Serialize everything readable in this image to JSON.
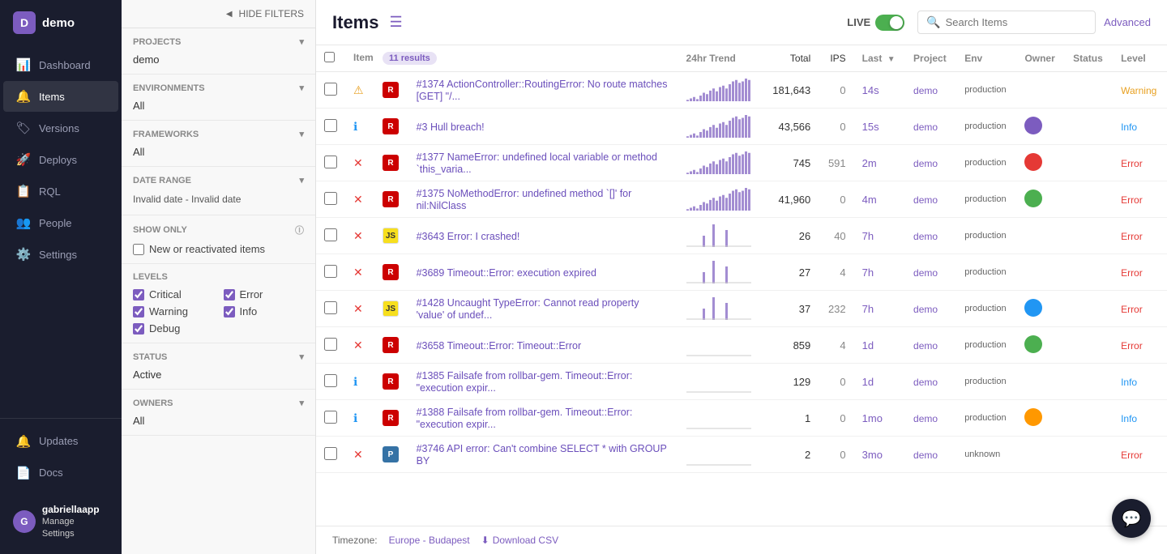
{
  "sidebar": {
    "app_name": "demo",
    "items": [
      {
        "label": "Dashboard",
        "icon": "📊",
        "id": "dashboard"
      },
      {
        "label": "Items",
        "icon": "🔔",
        "id": "items",
        "active": true
      },
      {
        "label": "Versions",
        "icon": "🏷",
        "id": "versions"
      },
      {
        "label": "Deploys",
        "icon": "🚀",
        "id": "deploys"
      },
      {
        "label": "RQL",
        "icon": "📋",
        "id": "rql"
      },
      {
        "label": "People",
        "icon": "👥",
        "id": "people"
      },
      {
        "label": "Settings",
        "icon": "⚙️",
        "id": "settings"
      }
    ],
    "bottom_items": [
      {
        "label": "Updates",
        "icon": "🔔",
        "id": "updates"
      },
      {
        "label": "Docs",
        "icon": "📄",
        "id": "docs"
      }
    ],
    "user": {
      "name": "gabriellaapp",
      "sub": "Manage Settings"
    }
  },
  "filters": {
    "hide_filters_label": "HIDE FILTERS",
    "projects_label": "PROJECTS",
    "project_value": "demo",
    "environments_label": "ENVIRONMENTS",
    "environments_value": "All",
    "frameworks_label": "FRAMEWORKS",
    "frameworks_value": "All",
    "date_range_label": "DATE RANGE",
    "date_range_value": "Invalid date - Invalid date",
    "show_only_label": "SHOW ONLY",
    "new_reactivated_label": "New or reactivated items",
    "levels_label": "LEVELS",
    "levels": [
      {
        "label": "Critical",
        "checked": true
      },
      {
        "label": "Error",
        "checked": true
      },
      {
        "label": "Warning",
        "checked": true
      },
      {
        "label": "Info",
        "checked": true
      },
      {
        "label": "Debug",
        "checked": true
      }
    ],
    "status_label": "STATUS",
    "status_value": "Active",
    "owners_label": "OWNERS",
    "owners_value": "All"
  },
  "main": {
    "title": "Items",
    "live_label": "LIVE",
    "search_placeholder": "Search Items",
    "advanced_label": "Advanced",
    "results_count": "11 results",
    "columns": {
      "item": "Item",
      "trend": "24hr Trend",
      "total": "Total",
      "ips": "IPS",
      "last": "Last",
      "project": "Project",
      "env": "Env",
      "owner": "Owner",
      "status": "Status",
      "level": "Level"
    },
    "items": [
      {
        "id": "#1374",
        "level": "Warning",
        "platform": "ruby",
        "title": "ActionController::RoutingError: No route matches [GET] \"/...",
        "total": "181,643",
        "ips": "0",
        "last": "14s",
        "project": "demo",
        "env": "production",
        "owner": "",
        "status": "",
        "level_badge": "Warning",
        "sparkline_type": "high"
      },
      {
        "id": "#3",
        "level": "Info",
        "platform": "ruby",
        "title": "Hull breach!",
        "total": "43,566",
        "ips": "0",
        "last": "15s",
        "project": "demo",
        "env": "production",
        "owner": "av1",
        "status": "",
        "level_badge": "Info",
        "sparkline_type": "high"
      },
      {
        "id": "#1377",
        "level": "Error",
        "platform": "ruby",
        "title": "NameError: undefined local variable or method `this_varia...",
        "total": "745",
        "ips": "591",
        "last": "2m",
        "project": "demo",
        "env": "production",
        "owner": "av2",
        "status": "",
        "level_badge": "Error",
        "sparkline_type": "high"
      },
      {
        "id": "#1375",
        "level": "Error",
        "platform": "ruby",
        "title": "NoMethodError: undefined method `[]' for nil:NilClass",
        "total": "41,960",
        "ips": "0",
        "last": "4m",
        "project": "demo",
        "env": "production",
        "owner": "av3",
        "status": "",
        "level_badge": "Error",
        "sparkline_type": "high"
      },
      {
        "id": "#3643",
        "level": "Error",
        "platform": "js",
        "title": "Error: I crashed!",
        "total": "26",
        "ips": "40",
        "last": "7h",
        "project": "demo",
        "env": "production",
        "owner": "",
        "status": "",
        "level_badge": "Error",
        "sparkline_type": "low"
      },
      {
        "id": "#3689",
        "level": "Error",
        "platform": "ruby",
        "title": "Timeout::Error: execution expired",
        "total": "27",
        "ips": "4",
        "last": "7h",
        "project": "demo",
        "env": "production",
        "owner": "",
        "status": "",
        "level_badge": "Error",
        "sparkline_type": "low"
      },
      {
        "id": "#1428",
        "level": "Error",
        "platform": "js",
        "title": "Uncaught TypeError: Cannot read property 'value' of undef...",
        "total": "37",
        "ips": "232",
        "last": "7h",
        "project": "demo",
        "env": "production",
        "owner": "av4",
        "status": "",
        "level_badge": "Error",
        "sparkline_type": "low"
      },
      {
        "id": "#3658",
        "level": "Error",
        "platform": "ruby",
        "title": "Timeout::Error: Timeout::Error",
        "total": "859",
        "ips": "4",
        "last": "1d",
        "project": "demo",
        "env": "production",
        "owner": "av3",
        "status": "",
        "level_badge": "Error",
        "sparkline_type": "flat"
      },
      {
        "id": "#1385",
        "level": "Info",
        "platform": "ruby",
        "title": "Failsafe from rollbar-gem. Timeout::Error: \"execution expir...",
        "total": "129",
        "ips": "0",
        "last": "1d",
        "project": "demo",
        "env": "production",
        "owner": "",
        "status": "",
        "level_badge": "Info",
        "sparkline_type": "flat"
      },
      {
        "id": "#1388",
        "level": "Info",
        "platform": "ruby",
        "title": "Failsafe from rollbar-gem. Timeout::Error: \"execution expir...",
        "total": "1",
        "ips": "0",
        "last": "1mo",
        "project": "demo",
        "env": "production",
        "owner": "av5",
        "status": "",
        "level_badge": "Info",
        "sparkline_type": "flat"
      },
      {
        "id": "#3746",
        "level": "Error",
        "platform": "python",
        "title": "API error: Can't combine SELECT * with GROUP BY",
        "total": "2",
        "ips": "0",
        "last": "3mo",
        "project": "demo",
        "env": "unknown",
        "owner": "",
        "status": "",
        "level_badge": "Error",
        "sparkline_type": "flat"
      }
    ],
    "footer": {
      "timezone_label": "Timezone:",
      "timezone_value": "Europe - Budapest",
      "download_label": "Download CSV"
    }
  }
}
